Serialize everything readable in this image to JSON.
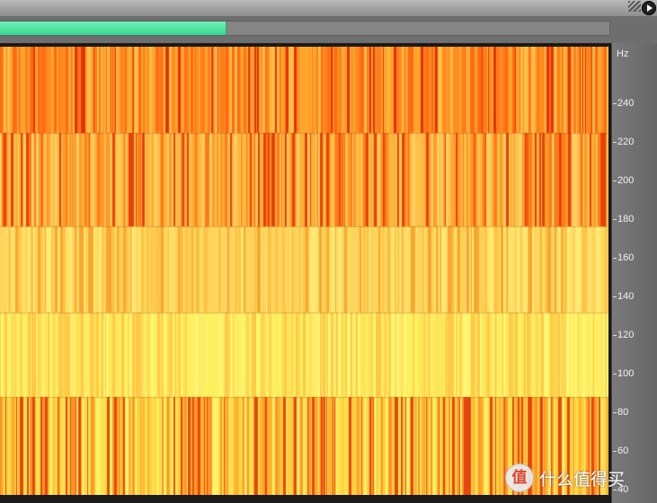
{
  "axis": {
    "unit": "Hz",
    "ticks": [
      {
        "label": "240",
        "hz": 240
      },
      {
        "label": "220",
        "hz": 220
      },
      {
        "label": "200",
        "hz": 200
      },
      {
        "label": "180",
        "hz": 180
      },
      {
        "label": "160",
        "hz": 160
      },
      {
        "label": "140",
        "hz": 140
      },
      {
        "label": "120",
        "hz": 120
      },
      {
        "label": "100",
        "hz": 100
      },
      {
        "label": "80",
        "hz": 80
      },
      {
        "label": "60",
        "hz": 60
      },
      {
        "label": "40",
        "hz": 40
      }
    ],
    "range_hz": [
      35,
      264
    ]
  },
  "scrollbar": {
    "position_fraction": 0.37
  },
  "spectrogram": {
    "bands": [
      {
        "from_hz": 220,
        "to_hz": 264,
        "palette": [
          "#ff8c1e",
          "#ff6a14",
          "#ffa52e",
          "#e2320a",
          "#ffbe46",
          "#ff7d1a"
        ]
      },
      {
        "from_hz": 172,
        "to_hz": 220,
        "palette": [
          "#ff9a28",
          "#ffc04a",
          "#e8400c",
          "#ffb23a",
          "#ffd060",
          "#ff7a18"
        ]
      },
      {
        "from_hz": 128,
        "to_hz": 172,
        "palette": [
          "#ffd65a",
          "#ffe068",
          "#ffc446",
          "#ffea72",
          "#f7a630",
          "#ffd25e"
        ]
      },
      {
        "from_hz": 85,
        "to_hz": 128,
        "palette": [
          "#fff060",
          "#ffe458",
          "#fff774",
          "#ffd44e",
          "#ffec66",
          "#ffc846"
        ]
      },
      {
        "from_hz": 35,
        "to_hz": 85,
        "palette": [
          "#ffe04c",
          "#ffd040",
          "#ffb22e",
          "#fff266",
          "#ff9428",
          "#e6460e"
        ]
      }
    ]
  },
  "watermark": {
    "logo": "值",
    "text": "什么值得买"
  },
  "colors": {
    "scroll_thumb": "#37d890",
    "panel": "#6a6a6a"
  }
}
